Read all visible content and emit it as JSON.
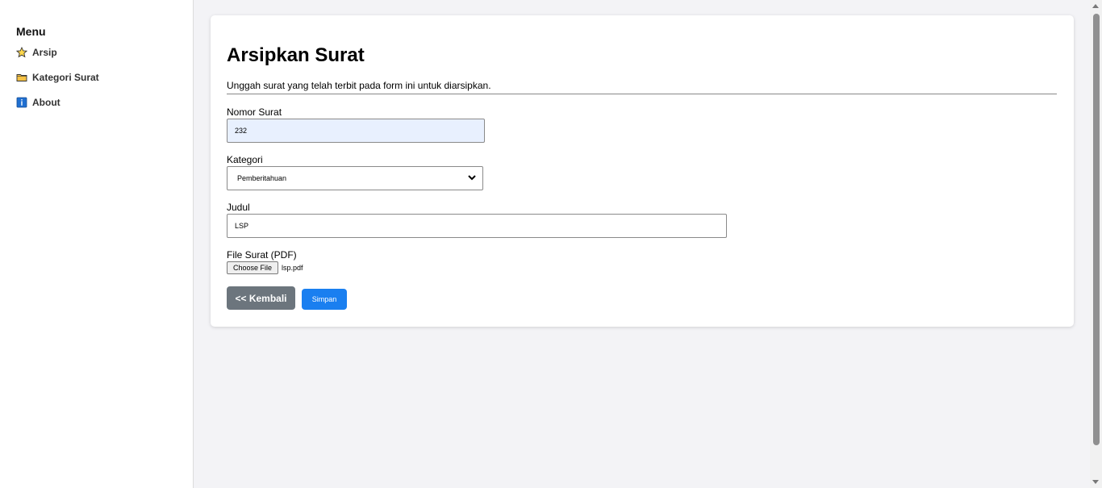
{
  "sidebar": {
    "heading": "Menu",
    "items": [
      {
        "label": "Arsip",
        "icon": "star-icon"
      },
      {
        "label": "Kategori Surat",
        "icon": "folder-icon"
      },
      {
        "label": "About",
        "icon": "info-icon"
      }
    ]
  },
  "form": {
    "title": "Arsipkan Surat",
    "description": "Unggah surat yang telah terbit pada form ini untuk diarsipkan.",
    "nomor_label": "Nomor Surat",
    "nomor_value": "232",
    "kategori_label": "Kategori",
    "kategori_value": "Pemberitahuan",
    "judul_label": "Judul",
    "judul_value": "LSP",
    "file_label": "File Surat (PDF)",
    "file_button": "Choose File",
    "file_name": "lsp.pdf",
    "back_label": "<< Kembali",
    "save_label": "Simpan"
  },
  "colors": {
    "back_button": "#6c757d",
    "save_button": "#1a7ff0",
    "autofill_bg": "#e8f0fe"
  }
}
